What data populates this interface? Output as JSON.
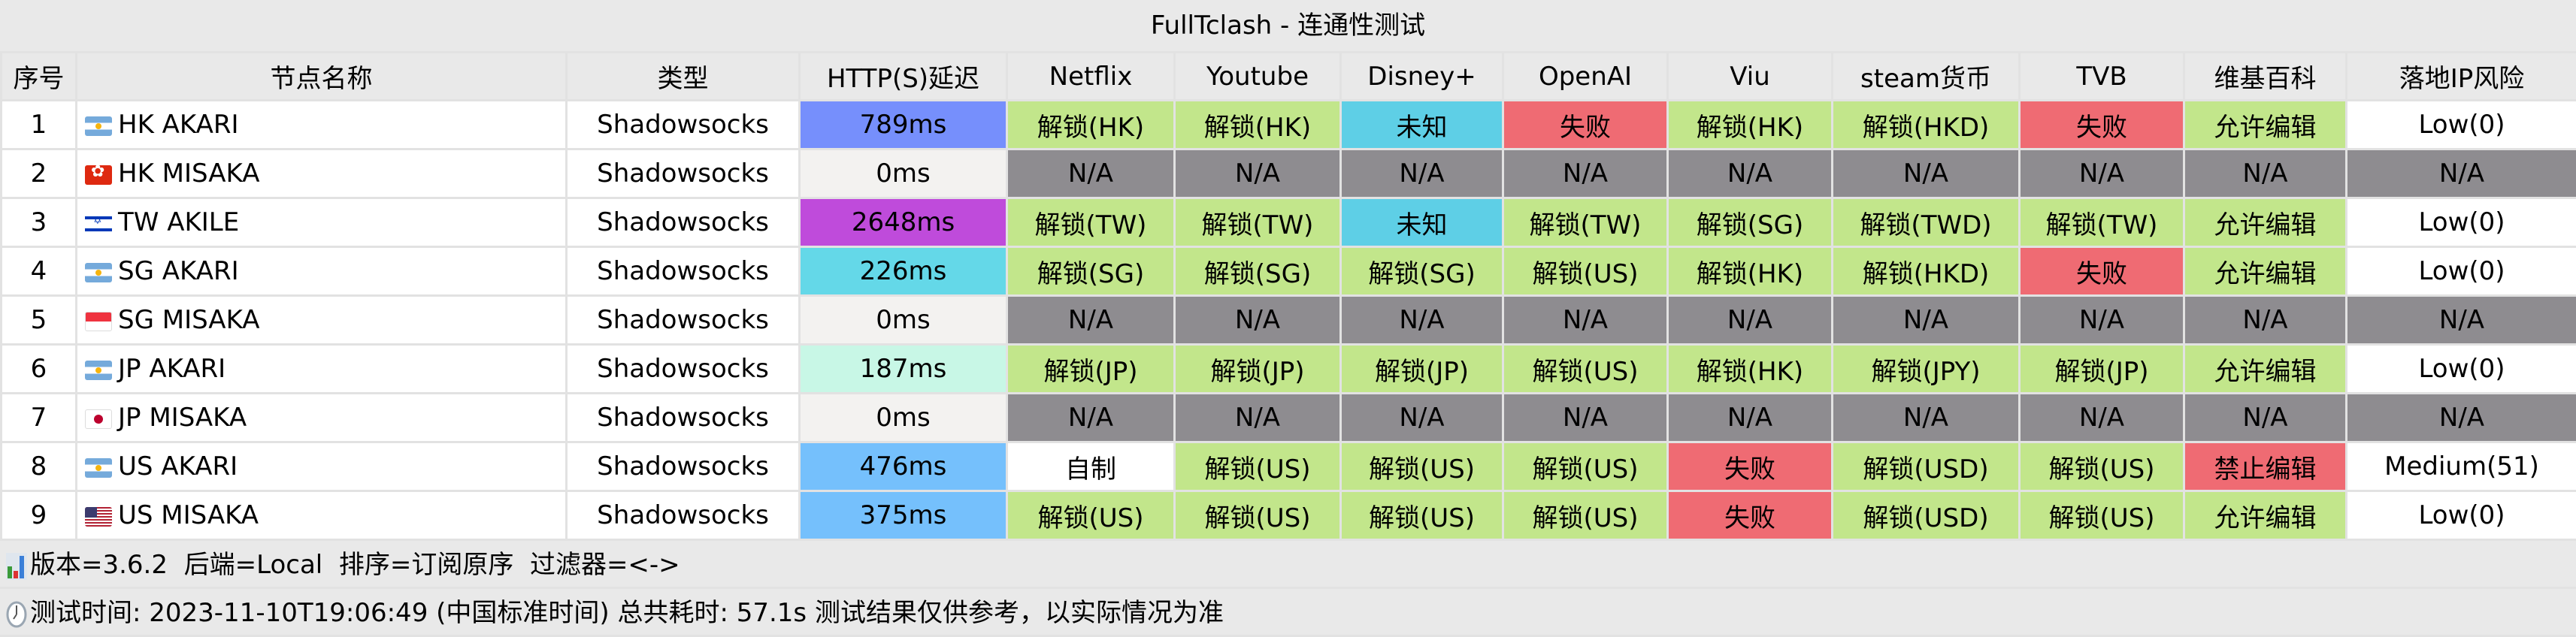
{
  "window": {
    "title": "FullTclash - 连通性测试"
  },
  "table": {
    "headers": [
      "序号",
      "节点名称",
      "类型",
      "HTTP(S)延迟",
      "Netflix",
      "Youtube",
      "Disney+",
      "OpenAI",
      "Viu",
      "steam货币",
      "TVB",
      "维基百科",
      "落地IP风险"
    ],
    "rows": [
      {
        "idx": "1",
        "flag": "argentina-flag",
        "name": "HK AKARI",
        "type": "Shadowsocks",
        "delay": "789ms",
        "delay_color": "#768ffc",
        "cells": [
          "解锁(HK)",
          "解锁(HK)",
          "未知",
          "失败",
          "解锁(HK)",
          "解锁(HKD)",
          "失败",
          "允许编辑",
          "Low(0)"
        ]
      },
      {
        "idx": "2",
        "flag": "hong-kong-flag",
        "name": "HK MISAKA",
        "type": "Shadowsocks",
        "delay": "0ms",
        "delay_color": "#f3f2f0",
        "cells": [
          "N/A",
          "N/A",
          "N/A",
          "N/A",
          "N/A",
          "N/A",
          "N/A",
          "N/A",
          "N/A"
        ]
      },
      {
        "idx": "3",
        "flag": "israel-flag",
        "name": "TW AKILE",
        "type": "Shadowsocks",
        "delay": "2648ms",
        "delay_color": "#bf4bdb",
        "cells": [
          "解锁(TW)",
          "解锁(TW)",
          "未知",
          "解锁(TW)",
          "解锁(SG)",
          "解锁(TWD)",
          "解锁(TW)",
          "允许编辑",
          "Low(0)"
        ]
      },
      {
        "idx": "4",
        "flag": "argentina-flag",
        "name": "SG AKARI",
        "type": "Shadowsocks",
        "delay": "226ms",
        "delay_color": "#64d8e8",
        "cells": [
          "解锁(SG)",
          "解锁(SG)",
          "解锁(SG)",
          "解锁(US)",
          "解锁(HK)",
          "解锁(HKD)",
          "失败",
          "允许编辑",
          "Low(0)"
        ]
      },
      {
        "idx": "5",
        "flag": "singapore-flag",
        "name": "SG MISAKA",
        "type": "Shadowsocks",
        "delay": "0ms",
        "delay_color": "#f3f2f0",
        "cells": [
          "N/A",
          "N/A",
          "N/A",
          "N/A",
          "N/A",
          "N/A",
          "N/A",
          "N/A",
          "N/A"
        ]
      },
      {
        "idx": "6",
        "flag": "argentina-flag",
        "name": "JP AKARI",
        "type": "Shadowsocks",
        "delay": "187ms",
        "delay_color": "#c8f7e6",
        "cells": [
          "解锁(JP)",
          "解锁(JP)",
          "解锁(JP)",
          "解锁(US)",
          "解锁(HK)",
          "解锁(JPY)",
          "解锁(JP)",
          "允许编辑",
          "Low(0)"
        ]
      },
      {
        "idx": "7",
        "flag": "japan-flag",
        "name": "JP MISAKA",
        "type": "Shadowsocks",
        "delay": "0ms",
        "delay_color": "#f3f2f0",
        "cells": [
          "N/A",
          "N/A",
          "N/A",
          "N/A",
          "N/A",
          "N/A",
          "N/A",
          "N/A",
          "N/A"
        ]
      },
      {
        "idx": "8",
        "flag": "argentina-flag",
        "name": "US AKARI",
        "type": "Shadowsocks",
        "delay": "476ms",
        "delay_color": "#75c0fc",
        "cells": [
          "自制",
          "解锁(US)",
          "解锁(US)",
          "解锁(US)",
          "失败",
          "解锁(USD)",
          "解锁(US)",
          "禁止编辑",
          "Medium(51)"
        ]
      },
      {
        "idx": "9",
        "flag": "usa-flag",
        "name": "US MISAKA",
        "type": "Shadowsocks",
        "delay": "375ms",
        "delay_color": "#75c0fc",
        "cells": [
          "解锁(US)",
          "解锁(US)",
          "解锁(US)",
          "解锁(US)",
          "失败",
          "解锁(USD)",
          "解锁(US)",
          "允许编辑",
          "Low(0)"
        ]
      }
    ]
  },
  "colors": {
    "unlock": "#c2e68b",
    "na": "#8e8c90",
    "fail": "#ef6b73",
    "unknown": "#5ecfe6",
    "self": "#ffffff",
    "risk": "#ffffff"
  },
  "footer": {
    "info": "版本=3.6.2  后端=Local  排序=订阅原序  过滤器=<->",
    "time": "测试时间: 2023-11-10T19:06:49 (中国标准时间) 总共耗时: 57.1s 测试结果仅供参考，以实际情况为准"
  }
}
